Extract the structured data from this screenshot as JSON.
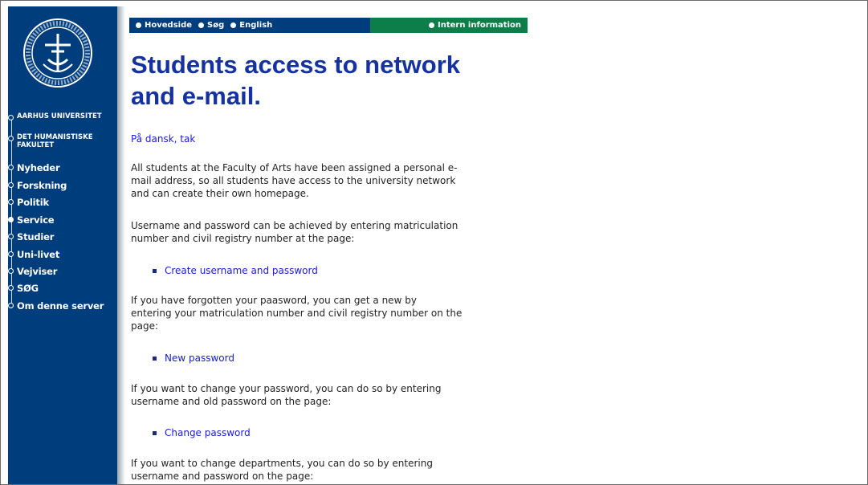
{
  "topbar": {
    "links": [
      "Hovedside",
      "Søg",
      "English"
    ],
    "right_link": "Intern information"
  },
  "sidebar": {
    "items": [
      {
        "label": "AARHUS UNIVERSITET",
        "active": false,
        "small": true
      },
      {
        "label": "DET HUMANISTISKE",
        "label2": "FAKULTET",
        "active": false,
        "small": true
      },
      {
        "label": "Nyheder",
        "active": false
      },
      {
        "label": "Forskning",
        "active": false
      },
      {
        "label": "Politik",
        "active": false
      },
      {
        "label": "Service",
        "active": true
      },
      {
        "label": "Studier",
        "active": false
      },
      {
        "label": "Uni-livet",
        "active": false
      },
      {
        "label": "Vejviser",
        "active": false
      },
      {
        "label": "SØG",
        "active": false
      },
      {
        "label": "Om denne server",
        "active": false
      }
    ]
  },
  "main": {
    "title_line1": "Students access to network",
    "title_line2": "and e-mail.",
    "danish_link": "På dansk, tak",
    "para1_l1": "All students at the Faculty of Arts have been assigned a personal e-",
    "para1_l2": "mail address, so all students have access to the university network",
    "para1_l3": "and can create their own homepage.",
    "para2_l1": "Username and password can be achieved by entering matriculation",
    "para2_l2": "number and civil registry number at the page:",
    "link1": "Create username and password",
    "para3_l1": "If you have forgotten your paasword, you can get a new by",
    "para3_l2": "entering your matriculation number and civil registry number on the",
    "para3_l3": "page:",
    "link2": "New password",
    "para4_l1": "If you want to change your password, you can do so by entering",
    "para4_l2": "username and old password on the page:",
    "link3": "Change password",
    "para5_l1": "If you want to change departments, you can do so by entering",
    "para5_l2": "username and password on the page:"
  }
}
